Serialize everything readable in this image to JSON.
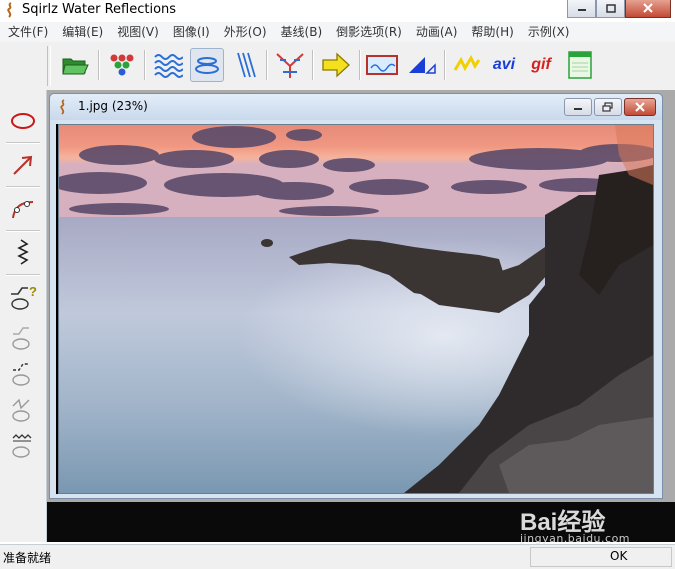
{
  "window": {
    "title": "Sqirlz Water Reflections",
    "icons": [
      "app-logo-icon",
      "minimize-icon",
      "maximize-icon",
      "close-icon"
    ]
  },
  "menubar": {
    "items": [
      "文件(F)",
      "编辑(E)",
      "视图(V)",
      "图像(I)",
      "外形(O)",
      "基线(B)",
      "倒影选项(R)",
      "动画(A)",
      "帮助(H)",
      "示例(X)"
    ]
  },
  "toolbar": {
    "buttons": [
      {
        "icon": "open-folder-icon"
      },
      {
        "icon": "color-dots-icon"
      },
      {
        "icon": "ripple-waves-icon"
      },
      {
        "icon": "ellipse-ripple-icon",
        "active": true
      },
      {
        "icon": "diagonal-rain-icon"
      },
      {
        "icon": "wind-lines-icon"
      },
      {
        "icon": "arrow-right-icon"
      },
      {
        "icon": "image-frame-icon"
      },
      {
        "icon": "triangle-measure-icon"
      },
      {
        "icon": "zigzag-icon"
      },
      {
        "icon": "avi-export-icon",
        "label": "avi"
      },
      {
        "icon": "gif-export-icon",
        "label": "gif"
      },
      {
        "icon": "window-panel-icon"
      }
    ],
    "colors": {
      "avi": "#1a3fd6",
      "gif": "#d82020"
    }
  },
  "left_toolbar": {
    "tools": [
      "ellipse-tool-icon",
      "arrow-tool-icon",
      "curve-tool-icon",
      "zigzag-tool-icon",
      "curve-help-icon",
      "curve-shape-1-icon",
      "curve-shape-2-icon",
      "curve-shape-3-icon",
      "curve-shape-4-icon"
    ]
  },
  "document": {
    "title": "1.jpg   (23%)",
    "image": "sunset-seascape-with-rocks"
  },
  "statusbar": {
    "left": "准备就绪",
    "right": "OK"
  },
  "watermark": {
    "logo": "Bai经验",
    "sub": "jingyan.baidu.com"
  }
}
